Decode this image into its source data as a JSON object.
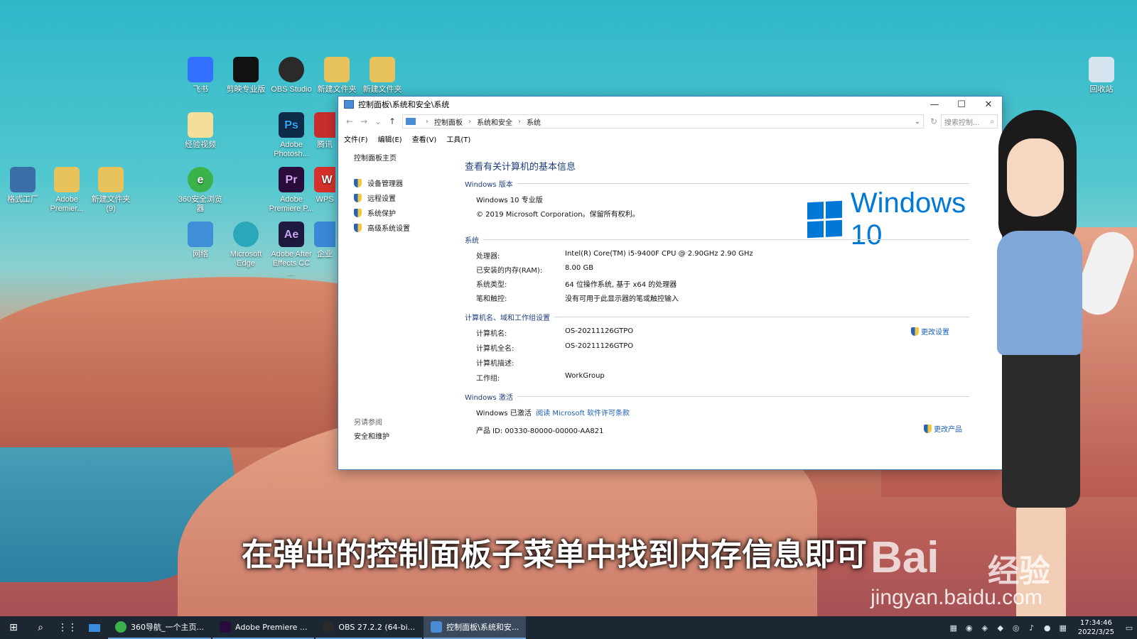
{
  "desktop": {
    "icons": [
      {
        "label": "飞书",
        "glyph": "",
        "color": "#3370ff"
      },
      {
        "label": "剪映专业版",
        "glyph": "",
        "color": "#111111"
      },
      {
        "label": "OBS Studio",
        "glyph": "",
        "color": "#2a2a2a"
      },
      {
        "label": "新建文件夹",
        "glyph": "",
        "color": "#e8c25a"
      },
      {
        "label": "新建文件夹",
        "glyph": "",
        "color": "#e8c25a"
      },
      {
        "label": "回收站",
        "glyph": "",
        "color": "#d6e4f0"
      },
      {
        "label": "经验视频",
        "glyph": "",
        "color": "#f3df9a"
      },
      {
        "label": "Adobe Photosh...",
        "glyph": "Ps",
        "color": "#0d2c4a"
      },
      {
        "label": "格式工厂",
        "glyph": "",
        "color": "#3c6ea8"
      },
      {
        "label": "Adobe Premier...",
        "glyph": "",
        "color": "#e8c25a"
      },
      {
        "label": "新建文件夹 (9)",
        "glyph": "",
        "color": "#e8c25a"
      },
      {
        "label": "360安全浏览器",
        "glyph": "e",
        "color": "#3bb34a"
      },
      {
        "label": "Adobe Premiere P...",
        "glyph": "Pr",
        "color": "#2a0c3c"
      },
      {
        "label": "WPS",
        "glyph": "W",
        "color": "#d6312c"
      },
      {
        "label": "网络",
        "glyph": "",
        "color": "#3f8ed8"
      },
      {
        "label": "Microsoft Edge",
        "glyph": "",
        "color": "#2aa7b8"
      },
      {
        "label": "Adobe After Effects CC ...",
        "glyph": "Ae",
        "color": "#1e1a3f"
      },
      {
        "label": "企业",
        "glyph": "",
        "color": "#3a89d6"
      },
      {
        "label": "腾讯",
        "glyph": "",
        "color": "#c62e2e"
      }
    ]
  },
  "window": {
    "title": "控制面板\\系统和安全\\系统",
    "controls": {
      "minimize": "—",
      "maximize": "☐",
      "close": "✕"
    },
    "nav": {
      "back": "←",
      "forward": "→",
      "recent": "⌄",
      "up": "↑",
      "refresh": "↻"
    },
    "breadcrumb": [
      "控制面板",
      "系统和安全",
      "系统"
    ],
    "search_placeholder": "搜索控制...",
    "menu": [
      "文件(F)",
      "编辑(E)",
      "查看(V)",
      "工具(T)"
    ],
    "left": {
      "home": "控制面板主页",
      "links": [
        "设备管理器",
        "远程设置",
        "系统保护",
        "高级系统设置"
      ],
      "see_also": "另请参阅",
      "security": "安全和维护"
    },
    "main": {
      "page_title": "查看有关计算机的基本信息",
      "edition_header": "Windows 版本",
      "edition": "Windows 10 专业版",
      "copyright": "© 2019 Microsoft Corporation。保留所有权利。",
      "logo_text": "Windows 10",
      "system_header": "系统",
      "system_rows": [
        {
          "k": "处理器:",
          "v": "Intel(R) Core(TM) i5-9400F CPU @ 2.90GHz   2.90 GHz"
        },
        {
          "k": "已安装的内存(RAM):",
          "v": "8.00 GB"
        },
        {
          "k": "系统类型:",
          "v": "64 位操作系统, 基于 x64 的处理器"
        },
        {
          "k": "笔和触控:",
          "v": "没有可用于此显示器的笔或触控输入"
        }
      ],
      "computer_header": "计算机名、域和工作组设置",
      "computer_rows": [
        {
          "k": "计算机名:",
          "v": "OS-20211126GTPO"
        },
        {
          "k": "计算机全名:",
          "v": "OS-20211126GTPO"
        },
        {
          "k": "计算机描述:",
          "v": ""
        },
        {
          "k": "工作组:",
          "v": "WorkGroup"
        }
      ],
      "change_settings": "更改设置",
      "activation_header": "Windows 激活",
      "activated": "Windows 已激活",
      "license_link": "阅读 Microsoft 软件许可条款",
      "product_id": "产品 ID: 00330-80000-00000-AA821",
      "change_key": "更改产品"
    }
  },
  "overlay": {
    "subtitle": "在弹出的控制面板子菜单中找到内存信息即可",
    "watermark_logo": "Bai",
    "watermark_logo2": "经验",
    "watermark_url": "jingyan.baidu.com"
  },
  "taskbar": {
    "start": "⊞",
    "search": "⌕",
    "apps_grid": "⋮⋮",
    "apps": [
      {
        "label": "360导航_一个主页...",
        "color": "#3bb34a",
        "active": false
      },
      {
        "label": "Adobe Premiere ...",
        "color": "#2a0c3c",
        "active": false
      },
      {
        "label": "OBS 27.2.2 (64-bi...",
        "color": "#2a2a2a",
        "active": false
      },
      {
        "label": "控制面板\\系统和安...",
        "color": "#4a8bd6",
        "active": true
      }
    ],
    "time": "17:34:46",
    "date": "2022/3/25"
  }
}
